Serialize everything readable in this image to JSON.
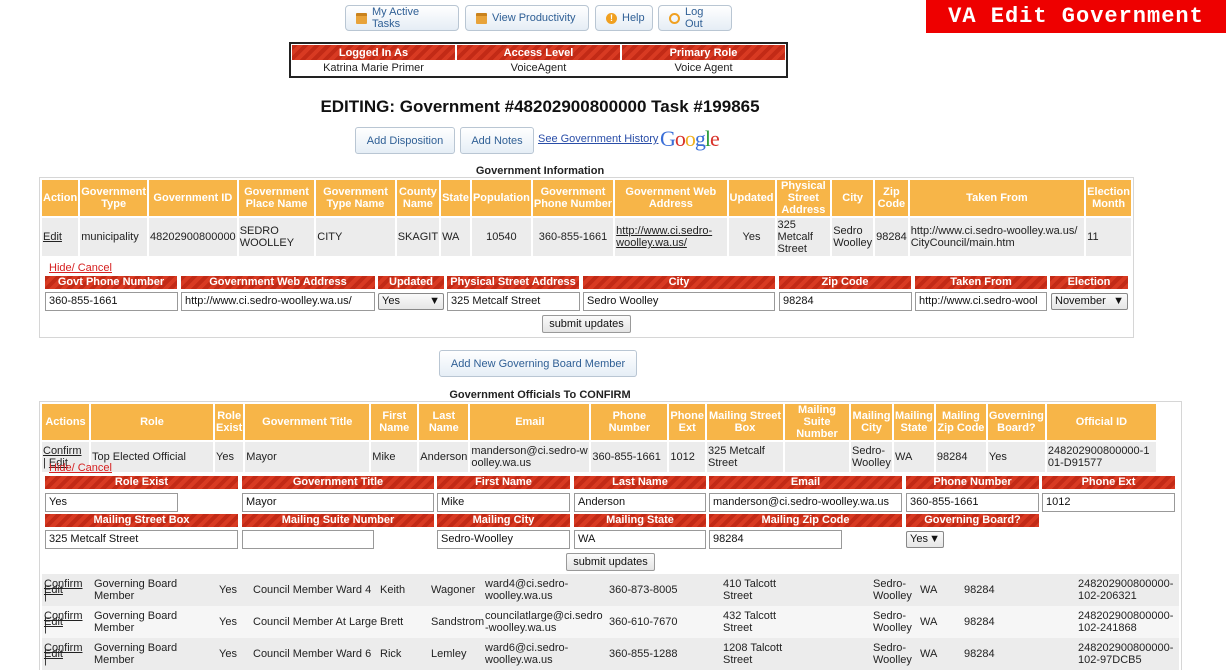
{
  "toolbar": {
    "active_tasks": "My Active Tasks",
    "productivity": "View Productivity",
    "help": "Help",
    "logout": "Log Out"
  },
  "banner": "VA Edit Government",
  "login": {
    "headers": [
      "Logged In As",
      "Access Level",
      "Primary Role"
    ],
    "values": [
      "Katrina Marie Primer",
      "VoiceAgent",
      "Voice Agent"
    ]
  },
  "title": "EDITING: Government #48202900800000 Task #199865",
  "actions": {
    "add_disposition": "Add Disposition",
    "add_notes": "Add Notes",
    "history": "See Government History",
    "google": "Google"
  },
  "gov_info": {
    "section_title": "Government Information",
    "headers": [
      "Action",
      "Government Type",
      "Government ID",
      "Government Place Name",
      "Government Type Name",
      "County Name",
      "State",
      "Population",
      "Government Phone Number",
      "Government Web Address",
      "Updated",
      "Physical Street Address",
      "City",
      "Zip Code",
      "Taken From",
      "Election Month"
    ],
    "row": {
      "action": "Edit",
      "type": "municipality",
      "id": "48202900800000",
      "place_name": "SEDRO WOOLLEY",
      "type_name": "CITY",
      "county": "SKAGIT",
      "state": "WA",
      "population": "10540",
      "phone": "360-855-1661",
      "web": "http://www.ci.sedro-woolley.wa.us/",
      "updated": "Yes",
      "street": "325 Metcalf Street",
      "city": "Sedro Woolley",
      "zip": "98284",
      "taken_from": "http://www.ci.sedro-woolley.wa.us/CityCouncil/main.htm",
      "election_month": "11"
    },
    "hide_cancel": "Hide/ Cancel",
    "edit_headers": [
      "Govt Phone Number",
      "Government Web Address",
      "Updated",
      "Physical Street Address",
      "City",
      "Zip Code",
      "Taken From",
      "Election Month"
    ],
    "edit_values": {
      "phone": "360-855-1661",
      "web": "http://www.ci.sedro-woolley.wa.us/",
      "updated": "Yes",
      "street": "325 Metcalf Street",
      "city": "Sedro Woolley",
      "zip": "98284",
      "taken_from": "http://www.ci.sedro-wool",
      "election_month": "November"
    },
    "submit": "submit updates"
  },
  "add_member": "Add New Governing Board Member",
  "officials": {
    "section_title": "Government Officials To CONFIRM",
    "headers": [
      "Actions",
      "Role",
      "Role Exist",
      "Government Title",
      "First Name",
      "Last Name",
      "Email",
      "Phone Number",
      "Phone Ext",
      "Mailing Street Box",
      "Mailing Suite Number",
      "Mailing City",
      "Mailing State",
      "Mailing Zip Code",
      "Governing Board?",
      "Official ID"
    ],
    "confirm": "Confirm",
    "edit": "Edit",
    "first": {
      "role": "Top Elected Official",
      "role_exist": "Yes",
      "title": "Mayor",
      "first": "Mike",
      "last": "Anderson",
      "email": "manderson@ci.sedro-woolley.wa.us",
      "phone": "360-855-1661",
      "ext": "1012",
      "street": "325 Metcalf Street",
      "suite": "",
      "city": "Sedro-Woolley",
      "state": "WA",
      "zip": "98284",
      "board": "Yes",
      "official_id": "248202900800000-101-D91577"
    },
    "hide_cancel": "Hide/ Cancel",
    "edit_headers_1": [
      "Role Exist",
      "Government Title",
      "First Name",
      "Last Name",
      "Email",
      "Phone Number",
      "Phone Ext"
    ],
    "edit_headers_2": [
      "Mailing Street Box",
      "Mailing Suite Number",
      "Mailing City",
      "Mailing State",
      "Mailing Zip Code",
      "Governing Board?"
    ],
    "edit_values": {
      "role_exist": "Yes",
      "title": "Mayor",
      "first": "Mike",
      "last": "Anderson",
      "email": "manderson@ci.sedro-woolley.wa.us",
      "phone": "360-855-1661",
      "ext": "1012",
      "street": "325 Metcalf Street",
      "suite": "",
      "city": "Sedro-Woolley",
      "state": "WA",
      "zip": "98284",
      "board": "Yes"
    },
    "submit": "submit updates",
    "rows": [
      {
        "role": "Governing Board Member",
        "role_exist": "Yes",
        "title": "Council Member Ward 4",
        "first": "Keith",
        "last": "Wagoner",
        "email": "ward4@ci.sedro-woolley.wa.us",
        "phone": "360-873-8005",
        "ext": "",
        "street": "410 Talcott Street",
        "city": "Sedro-Woolley",
        "state": "WA",
        "zip": "98284",
        "board": "",
        "official_id": "248202900800000-102-206321"
      },
      {
        "role": "Governing Board Member",
        "role_exist": "Yes",
        "title": "Council Member At Large",
        "first": "Brett",
        "last": "Sandstrom",
        "email": "councilatlarge@ci.sedro-woolley.wa.us",
        "phone": "360-610-7670",
        "ext": "",
        "street": "432 Talcott Street",
        "city": "Sedro-Woolley",
        "state": "WA",
        "zip": "98284",
        "board": "",
        "official_id": "248202900800000-102-241868"
      },
      {
        "role": "Governing Board Member",
        "role_exist": "Yes",
        "title": "Council Member Ward 6",
        "first": "Rick",
        "last": "Lemley",
        "email": "ward6@ci.sedro-woolley.wa.us",
        "phone": "360-855-1288",
        "ext": "",
        "street": "1208 Talcott Street",
        "city": "Sedro-Woolley",
        "state": "WA",
        "zip": "98284",
        "board": "",
        "official_id": "248202900800000-102-97DCB5"
      }
    ]
  }
}
